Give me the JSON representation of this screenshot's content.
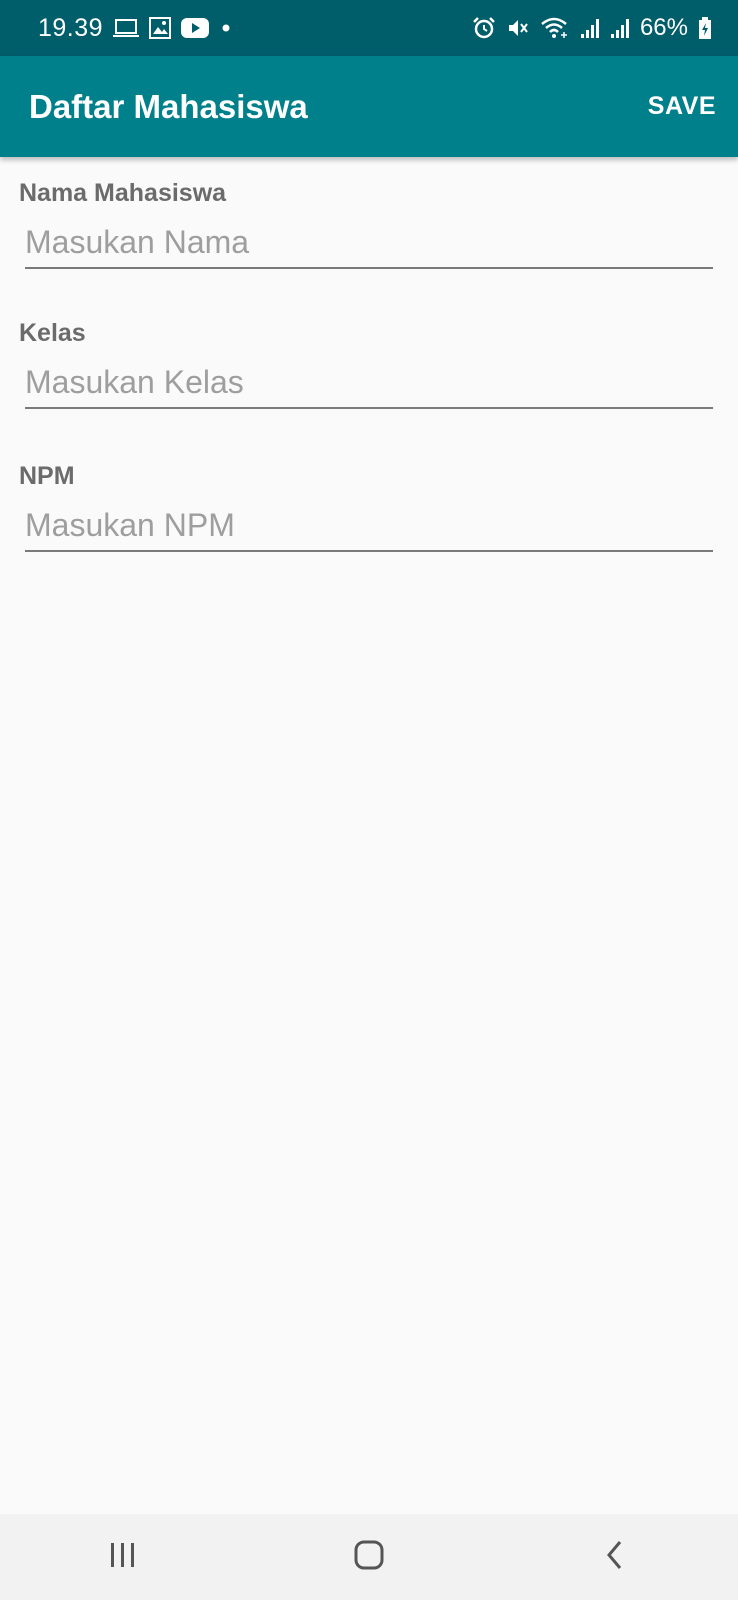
{
  "status_bar": {
    "time": "19.39",
    "left_icons": [
      "laptop-icon",
      "image-icon",
      "youtube-icon",
      "dot-icon"
    ],
    "right_icons": [
      "alarm-icon",
      "mute-icon",
      "wifi-icon",
      "signal-icon",
      "signal-icon",
      "battery-icon"
    ],
    "battery": "66%"
  },
  "app_bar": {
    "title": "Daftar Mahasiswa",
    "save_label": "SAVE",
    "color": "#00808a"
  },
  "form": {
    "fields": [
      {
        "label": "Nama Mahasiswa",
        "placeholder": "Masukan Nama",
        "value": ""
      },
      {
        "label": "Kelas",
        "placeholder": "Masukan Kelas",
        "value": ""
      },
      {
        "label": "NPM",
        "placeholder": "Masukan NPM",
        "value": ""
      }
    ]
  },
  "nav_bar": {
    "buttons": [
      "recent-apps-icon",
      "home-icon",
      "back-icon"
    ]
  },
  "colors": {
    "status_bar": "#005d6a",
    "accent": "#00808a",
    "background": "#fafafa"
  }
}
